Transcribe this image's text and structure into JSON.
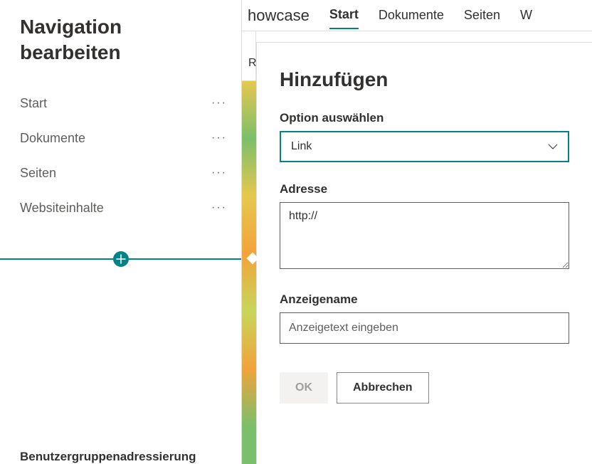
{
  "sidebar": {
    "title": "Navigation bearbeiten",
    "items": [
      {
        "label": "Start"
      },
      {
        "label": "Dokumente"
      },
      {
        "label": "Seiten"
      },
      {
        "label": "Websiteinhalte"
      }
    ],
    "bottom_label": "Benutzergruppenadressierung"
  },
  "topnav": {
    "brand_fragment": "howcase",
    "tabs": [
      {
        "label": "Start",
        "active": true
      },
      {
        "label": "Dokumente",
        "active": false
      },
      {
        "label": "Seiten",
        "active": false
      }
    ],
    "partial": "W"
  },
  "stray_r": "R",
  "panel": {
    "title": "Hinzufügen",
    "option_label": "Option auswählen",
    "option_value": "Link",
    "address_label": "Adresse",
    "address_value": "http://",
    "displayname_label": "Anzeigename",
    "displayname_placeholder": "Anzeigetext eingeben",
    "ok_label": "OK",
    "cancel_label": "Abbrechen"
  }
}
